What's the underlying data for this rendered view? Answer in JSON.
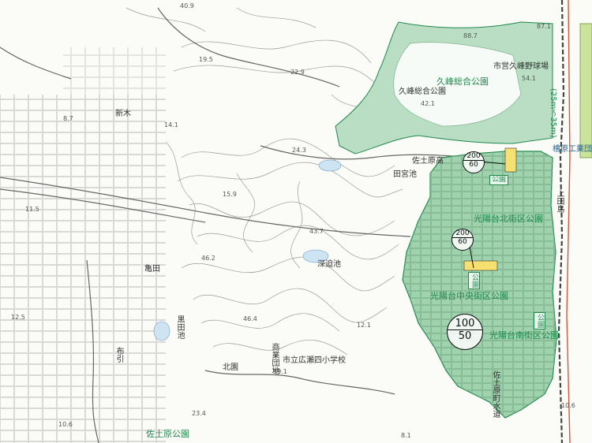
{
  "map": {
    "parks": {
      "kumine_sogo": "久峰総合公園",
      "kumine_sogo_inner": "久峰総合公園",
      "kumine_baseball": "市営久峰野球場",
      "koyo_north": "光陽台北街区公園",
      "koyo_central": "光陽台中央街区公園",
      "koyo_south": "光陽台南街区公園",
      "sado_park": "佐土原公園",
      "park_badge": "公園",
      "park_badge_vert": "公園"
    },
    "places": {
      "saisho": "佐土原高",
      "tamiyaike": "田宮池",
      "fukasako": "深迫池",
      "kurodaike": "黒田池",
      "shinki": "新木",
      "kameda": "亀田",
      "hirose4": "市立広瀬四小学校",
      "kitazono": "北園",
      "school_vert": "佐土原町水道",
      "nunobiki": "布引",
      "kamiatae": "上田島",
      "shokudo": "商業団地",
      "road_width": "(25m〜35m)",
      "hinoki": "檜原工業団地"
    },
    "ratios": [
      {
        "top": "200",
        "bottom": "60"
      },
      {
        "top": "200",
        "bottom": "60"
      },
      {
        "top": "100",
        "bottom": "50"
      }
    ],
    "elevations": [
      "40.9",
      "19.5",
      "22.9",
      "14.1",
      "8.7",
      "24.3",
      "11.5",
      "15.9",
      "43.7",
      "46.2",
      "12.5",
      "46.4",
      "12.1",
      "59.1",
      "42.1",
      "23.4",
      "10.6",
      "8.1",
      "10.6",
      "88.7",
      "54.1",
      "87.1"
    ],
    "colors": {
      "park_fill": "#b9dec3",
      "park_fill_dense": "#9fd2ad",
      "park_border": "#1f8a4c",
      "facility": "#f6e070",
      "boundary": "#d25a3c",
      "contour": "#9a9a9a"
    }
  }
}
